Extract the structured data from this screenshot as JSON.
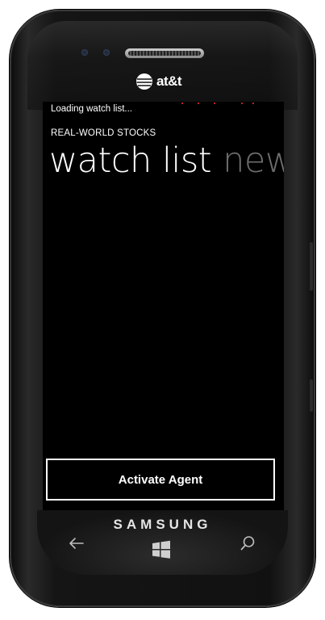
{
  "device": {
    "carrier": "at&t",
    "brand": "SAMSUNG"
  },
  "app": {
    "status_text": "Loading watch list...",
    "title": "REAL-WORLD STOCKS",
    "pivot_tabs": [
      {
        "label": "watch list",
        "active": true
      },
      {
        "label": "news",
        "active": false
      }
    ],
    "activate_button_label": "Activate Agent"
  },
  "hardware_keys": [
    {
      "name": "back-icon"
    },
    {
      "name": "windows-start-icon"
    },
    {
      "name": "search-icon"
    }
  ],
  "colors": {
    "screen_background": "#000000",
    "text_primary": "#ffffff",
    "text_inactive_tab": "#6e6e6e",
    "loading_dots": "#c41f1f"
  }
}
